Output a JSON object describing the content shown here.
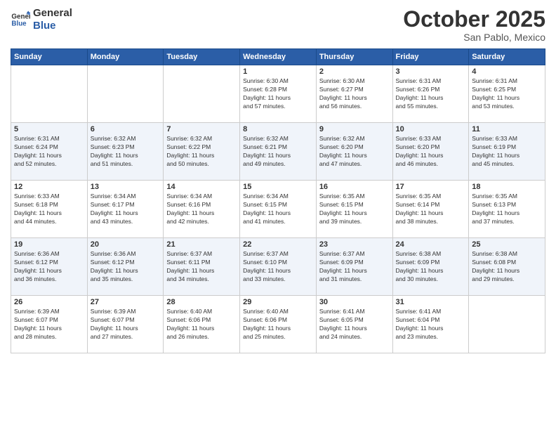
{
  "header": {
    "logo_line1": "General",
    "logo_line2": "Blue",
    "month": "October 2025",
    "location": "San Pablo, Mexico"
  },
  "days_of_week": [
    "Sunday",
    "Monday",
    "Tuesday",
    "Wednesday",
    "Thursday",
    "Friday",
    "Saturday"
  ],
  "weeks": [
    [
      {
        "day": "",
        "info": ""
      },
      {
        "day": "",
        "info": ""
      },
      {
        "day": "",
        "info": ""
      },
      {
        "day": "1",
        "info": "Sunrise: 6:30 AM\nSunset: 6:28 PM\nDaylight: 11 hours\nand 57 minutes."
      },
      {
        "day": "2",
        "info": "Sunrise: 6:30 AM\nSunset: 6:27 PM\nDaylight: 11 hours\nand 56 minutes."
      },
      {
        "day": "3",
        "info": "Sunrise: 6:31 AM\nSunset: 6:26 PM\nDaylight: 11 hours\nand 55 minutes."
      },
      {
        "day": "4",
        "info": "Sunrise: 6:31 AM\nSunset: 6:25 PM\nDaylight: 11 hours\nand 53 minutes."
      }
    ],
    [
      {
        "day": "5",
        "info": "Sunrise: 6:31 AM\nSunset: 6:24 PM\nDaylight: 11 hours\nand 52 minutes."
      },
      {
        "day": "6",
        "info": "Sunrise: 6:32 AM\nSunset: 6:23 PM\nDaylight: 11 hours\nand 51 minutes."
      },
      {
        "day": "7",
        "info": "Sunrise: 6:32 AM\nSunset: 6:22 PM\nDaylight: 11 hours\nand 50 minutes."
      },
      {
        "day": "8",
        "info": "Sunrise: 6:32 AM\nSunset: 6:21 PM\nDaylight: 11 hours\nand 49 minutes."
      },
      {
        "day": "9",
        "info": "Sunrise: 6:32 AM\nSunset: 6:20 PM\nDaylight: 11 hours\nand 47 minutes."
      },
      {
        "day": "10",
        "info": "Sunrise: 6:33 AM\nSunset: 6:20 PM\nDaylight: 11 hours\nand 46 minutes."
      },
      {
        "day": "11",
        "info": "Sunrise: 6:33 AM\nSunset: 6:19 PM\nDaylight: 11 hours\nand 45 minutes."
      }
    ],
    [
      {
        "day": "12",
        "info": "Sunrise: 6:33 AM\nSunset: 6:18 PM\nDaylight: 11 hours\nand 44 minutes."
      },
      {
        "day": "13",
        "info": "Sunrise: 6:34 AM\nSunset: 6:17 PM\nDaylight: 11 hours\nand 43 minutes."
      },
      {
        "day": "14",
        "info": "Sunrise: 6:34 AM\nSunset: 6:16 PM\nDaylight: 11 hours\nand 42 minutes."
      },
      {
        "day": "15",
        "info": "Sunrise: 6:34 AM\nSunset: 6:15 PM\nDaylight: 11 hours\nand 41 minutes."
      },
      {
        "day": "16",
        "info": "Sunrise: 6:35 AM\nSunset: 6:15 PM\nDaylight: 11 hours\nand 39 minutes."
      },
      {
        "day": "17",
        "info": "Sunrise: 6:35 AM\nSunset: 6:14 PM\nDaylight: 11 hours\nand 38 minutes."
      },
      {
        "day": "18",
        "info": "Sunrise: 6:35 AM\nSunset: 6:13 PM\nDaylight: 11 hours\nand 37 minutes."
      }
    ],
    [
      {
        "day": "19",
        "info": "Sunrise: 6:36 AM\nSunset: 6:12 PM\nDaylight: 11 hours\nand 36 minutes."
      },
      {
        "day": "20",
        "info": "Sunrise: 6:36 AM\nSunset: 6:12 PM\nDaylight: 11 hours\nand 35 minutes."
      },
      {
        "day": "21",
        "info": "Sunrise: 6:37 AM\nSunset: 6:11 PM\nDaylight: 11 hours\nand 34 minutes."
      },
      {
        "day": "22",
        "info": "Sunrise: 6:37 AM\nSunset: 6:10 PM\nDaylight: 11 hours\nand 33 minutes."
      },
      {
        "day": "23",
        "info": "Sunrise: 6:37 AM\nSunset: 6:09 PM\nDaylight: 11 hours\nand 31 minutes."
      },
      {
        "day": "24",
        "info": "Sunrise: 6:38 AM\nSunset: 6:09 PM\nDaylight: 11 hours\nand 30 minutes."
      },
      {
        "day": "25",
        "info": "Sunrise: 6:38 AM\nSunset: 6:08 PM\nDaylight: 11 hours\nand 29 minutes."
      }
    ],
    [
      {
        "day": "26",
        "info": "Sunrise: 6:39 AM\nSunset: 6:07 PM\nDaylight: 11 hours\nand 28 minutes."
      },
      {
        "day": "27",
        "info": "Sunrise: 6:39 AM\nSunset: 6:07 PM\nDaylight: 11 hours\nand 27 minutes."
      },
      {
        "day": "28",
        "info": "Sunrise: 6:40 AM\nSunset: 6:06 PM\nDaylight: 11 hours\nand 26 minutes."
      },
      {
        "day": "29",
        "info": "Sunrise: 6:40 AM\nSunset: 6:06 PM\nDaylight: 11 hours\nand 25 minutes."
      },
      {
        "day": "30",
        "info": "Sunrise: 6:41 AM\nSunset: 6:05 PM\nDaylight: 11 hours\nand 24 minutes."
      },
      {
        "day": "31",
        "info": "Sunrise: 6:41 AM\nSunset: 6:04 PM\nDaylight: 11 hours\nand 23 minutes."
      },
      {
        "day": "",
        "info": ""
      }
    ]
  ]
}
